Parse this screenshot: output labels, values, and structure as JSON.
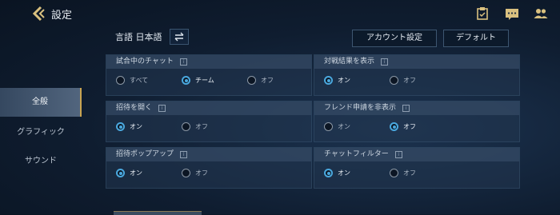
{
  "header": {
    "title": "設定",
    "back_icon": "back-chevron-icon"
  },
  "top_icons": [
    "clipboard-icon",
    "chat-icon",
    "friends-icon"
  ],
  "sidebar": {
    "items": [
      {
        "label": "全般",
        "active": true
      },
      {
        "label": "グラフィック",
        "active": false
      },
      {
        "label": "サウンド",
        "active": false
      }
    ]
  },
  "language": {
    "label": "言語 日本語",
    "swap_icon": "swap-icon"
  },
  "buttons": {
    "account": "アカウント設定",
    "default": "デフォルト"
  },
  "info_icon": "i",
  "panels": [
    {
      "title": "試合中のチャット",
      "options": [
        "すべて",
        "チーム",
        "オフ"
      ],
      "selected": 1
    },
    {
      "title": "対戦結果を表示",
      "options": [
        "オン",
        "オフ"
      ],
      "selected": 0
    },
    {
      "title": "招待を開く",
      "options": [
        "オン",
        "オフ"
      ],
      "selected": 0
    },
    {
      "title": "フレンド申請を非表示",
      "options": [
        "オン",
        "オフ"
      ],
      "selected": 1
    },
    {
      "title": "招待ポップアップ",
      "options": [
        "オン",
        "オフ"
      ],
      "selected": 0
    },
    {
      "title": "チャットフィルター",
      "options": [
        "オン",
        "オフ"
      ],
      "selected": 0
    }
  ]
}
